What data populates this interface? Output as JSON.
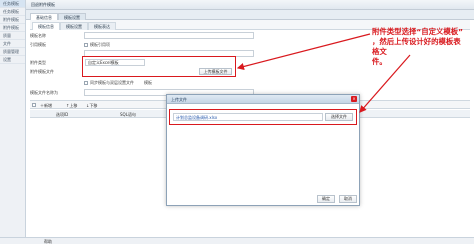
{
  "sidebar": {
    "items": [
      {
        "label": "任务模板"
      },
      {
        "label": "任务模板"
      },
      {
        "label": "附件模板"
      },
      {
        "label": "附件模板"
      },
      {
        "label": "质量"
      },
      {
        "label": "文件"
      },
      {
        "label": "质量管理"
      },
      {
        "label": "设置"
      }
    ]
  },
  "main": {
    "title": "回退附件模板",
    "tabs": [
      {
        "label": "基础信息"
      },
      {
        "label": "模板设置"
      }
    ],
    "subtabs": [
      {
        "label": "模板信息"
      },
      {
        "label": "模板设置"
      },
      {
        "label": "模板表达"
      }
    ]
  },
  "form": {
    "template_name_label": "模板名称",
    "code_label": "引用模板",
    "checkbox1_label": "模板引用项",
    "attach_type_label": "附件类型",
    "attach_type_value": "自定义Excel模板",
    "attach_file_label": "附件模板文件",
    "upload_button": "上传模板文件",
    "checkbox2_label": "同步模板与双层设置文件",
    "checkbox2b_label": "模板",
    "template_file_name_label": "模板文件名称为"
  },
  "toolbar": {
    "add_label": "新增",
    "up_label": "上移",
    "down_label": "下移"
  },
  "grid": {
    "col1": "选项ID",
    "col2": "SQL语句"
  },
  "bottombar": {
    "label": "帮助"
  },
  "dialog": {
    "title": "上传文件",
    "file_value": "计划总监设备调研.xlsx",
    "browse_label": "选择文件",
    "ok_label": "确定",
    "cancel_label": "取消",
    "close_glyph": "×"
  },
  "annotation": {
    "line1": "附件类型选择“自定义模板”",
    "line2": "，然后上传设计好的模板表格文",
    "line3": "件。"
  },
  "colors": {
    "accent_red": "#d9191e",
    "link_blue": "#2255aa"
  }
}
